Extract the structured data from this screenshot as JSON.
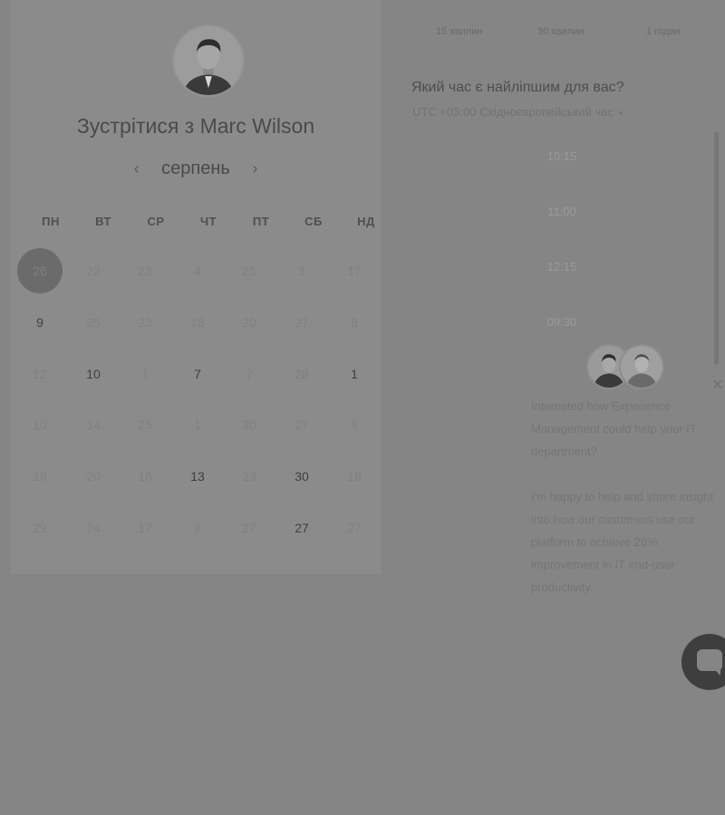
{
  "scheduler": {
    "title": "Зустрітися з Marc Wilson",
    "month": "серпень",
    "prev_icon": "chevron-left-icon",
    "next_icon": "chevron-right-icon",
    "weekdays": [
      "ПН",
      "ВТ",
      "СР",
      "ЧТ",
      "ПТ",
      "СБ",
      "НД"
    ],
    "weeks": [
      [
        "26",
        "22",
        "23",
        "4",
        "25",
        "3",
        "17"
      ],
      [
        "9",
        "25",
        "23",
        "18",
        "20",
        "27",
        "8"
      ],
      [
        "12",
        "10",
        "1",
        "7",
        "7",
        "28",
        "1"
      ],
      [
        "10",
        "14",
        "25",
        "1",
        "30",
        "27",
        "8"
      ],
      [
        "19",
        "20",
        "16",
        "13",
        "23",
        "30",
        "19"
      ],
      [
        "29",
        "24",
        "17",
        "8",
        "27",
        "27",
        "27"
      ]
    ],
    "available_days": [
      "9",
      "10",
      "7",
      "1",
      "13",
      "30",
      "27"
    ],
    "selected_day": "26"
  },
  "booking": {
    "durations": [
      "15 хвилин",
      "30 хвилин",
      "1 годин"
    ],
    "best_time_label": "Який час є найліпшим для вас?",
    "timezone": "UTC +03:00 Східноєвропейський час",
    "timezone_caret": "▾",
    "time_slots": [
      "10:15",
      "11:00",
      "12:15",
      "09:30"
    ]
  },
  "chat": {
    "message_1": "Interested how Experience Management could help your IT department?",
    "message_2": "I'm happy to help and share insight into how our customers use our platform to achieve 26% improvement in IT end-user productivity.",
    "close_label": "×"
  },
  "colors": {
    "overlay_background": "#858585",
    "card_background": "#8b8b8b",
    "selected_day": "#6b6b6b",
    "launcher": "#3e3e3e"
  }
}
